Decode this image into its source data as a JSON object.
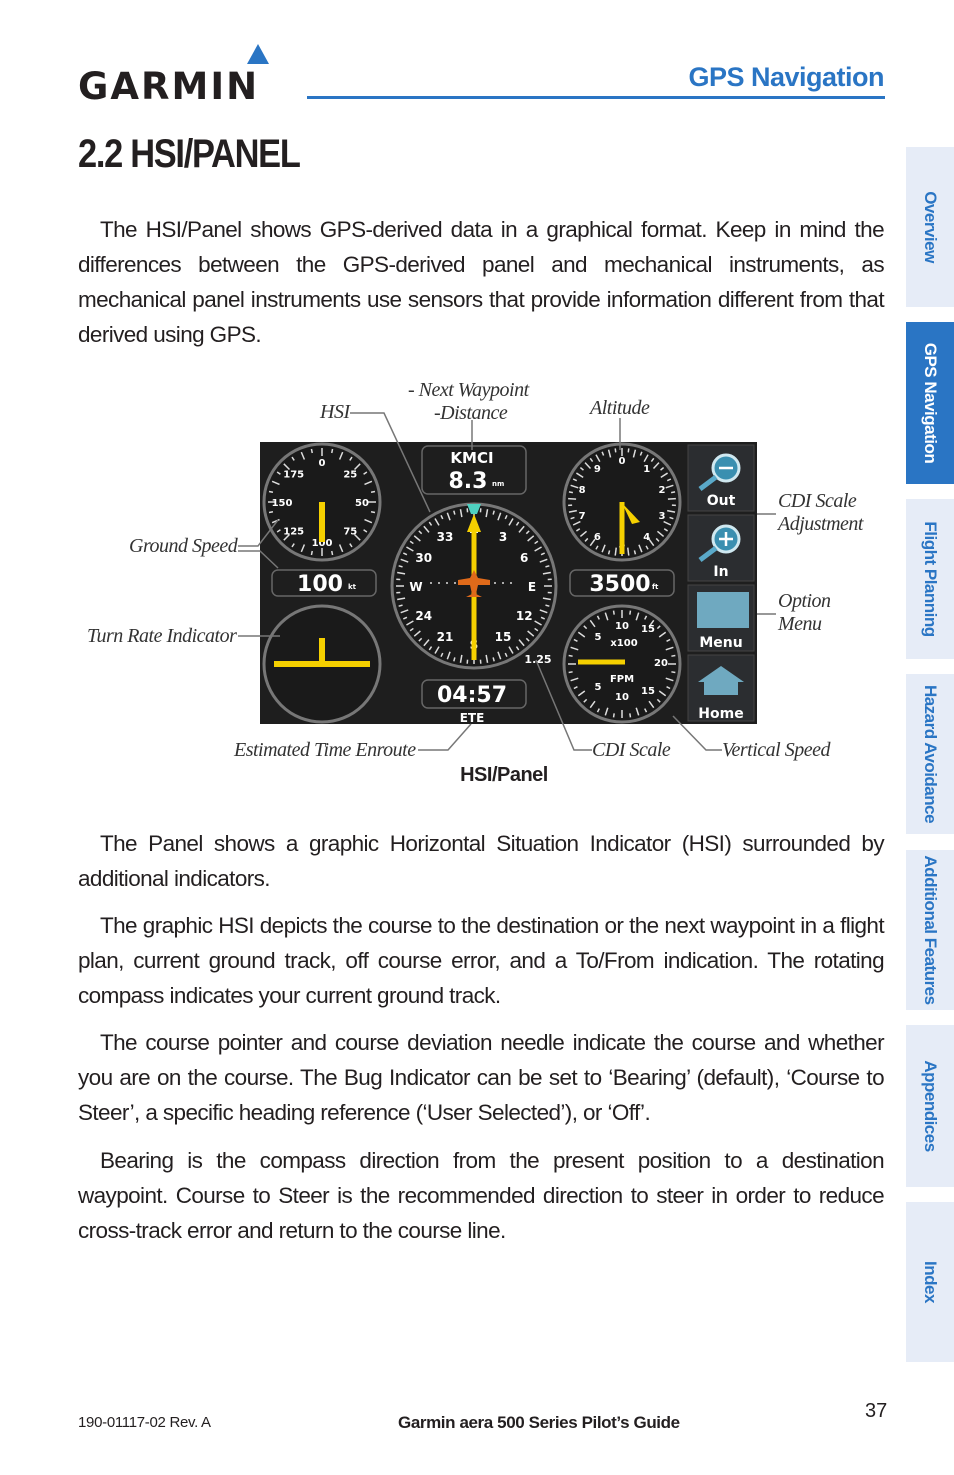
{
  "header": {
    "logo_text": "GARMIN",
    "section_title": "GPS Navigation",
    "page_heading": "2.2  HSI/PANEL"
  },
  "body": {
    "paragraphs": [
      "The HSI/Panel shows GPS-derived data in a graphical format.  Keep in mind the differences between the GPS-derived panel and mechanical instruments, as mechanical panel instruments use sensors that provide information different from that derived using GPS.",
      "The Panel shows a graphic Horizontal Situation Indicator (HSI) surrounded by additional indicators.",
      "The graphic HSI depicts the course to the destination or the next waypoint in a flight plan, current ground track, off course error, and a To/From indication.  The rotating compass indicates your current ground track.",
      "The course pointer and course deviation needle indicate the course and whether you are on the course.  The Bug Indicator can be set to ‘Bearing’ (default), ‘Course to Steer’, a specific heading reference (‘User Selected’), or ‘Off’.",
      "Bearing is the compass direction from the present position to a destination waypoint. Course to Steer is the recommended direction to steer in order to reduce cross-track error and return to the course line."
    ]
  },
  "figure": {
    "caption": "HSI/Panel",
    "callouts": {
      "hsi": "HSI",
      "next_waypoint_1": "- Next Waypoint",
      "next_waypoint_2": "-Distance",
      "altitude": "Altitude",
      "ground_speed": "Ground Speed",
      "turn_rate": "Turn Rate Indicator",
      "ete": "Estimated Time Enroute",
      "cdi_scale": "CDI Scale",
      "vertical_speed": "Vertical Speed",
      "cdi_adjust_1": "CDI Scale",
      "cdi_adjust_2": "Adjustment",
      "option_menu_1": "Option",
      "option_menu_2": "Menu"
    },
    "panel": {
      "waypoint": "KMCI",
      "distance": "8.3",
      "distance_unit": "nm",
      "ground_speed": "100",
      "ground_speed_unit": "kt",
      "altitude": "3500",
      "altitude_unit": "ft",
      "ete_value": "04:57",
      "ete_label": "ETE",
      "cdi_scale": "1.25",
      "speed_ticks": [
        "0",
        "25",
        "50",
        "75",
        "100",
        "125",
        "150",
        "175"
      ],
      "alt_ticks": [
        "0",
        "1",
        "2",
        "3",
        "4",
        "5",
        "6",
        "7",
        "8",
        "9"
      ],
      "compass_labels": [
        "N",
        "3",
        "6",
        "E",
        "12",
        "15",
        "S",
        "21",
        "24",
        "W",
        "30",
        "33"
      ],
      "vsi_labels": {
        "up10": "10",
        "up15": "15",
        "up5": "5",
        "x": "x100",
        "up20": "20",
        "fpm": "FPM",
        "dn5": "5",
        "dn10": "10",
        "dn15": "15"
      },
      "buttons": {
        "out": "Out",
        "in": "In",
        "menu": "Menu",
        "home": "Home"
      },
      "colors": {
        "background": "#1e1e1e",
        "needle": "#f5d000",
        "aircraft": "#e06a1a",
        "bearing_bug": "#4fd0c0"
      }
    }
  },
  "side_tabs": [
    {
      "label": "Overview",
      "active": false
    },
    {
      "label": "GPS Navigation",
      "active": true
    },
    {
      "label": "Flight Planning",
      "active": false
    },
    {
      "label": "Hazard Avoidance",
      "active": false
    },
    {
      "label": "Additional Features",
      "active": false
    },
    {
      "label": "Appendices",
      "active": false
    },
    {
      "label": "Index",
      "active": false
    }
  ],
  "footer": {
    "doc_number": "190-01117-02 Rev. A",
    "guide_title": "Garmin aera 500 Series Pilot’s Guide",
    "page_number": "37"
  },
  "colors": {
    "accent": "#2a75c4",
    "tab_bg": "#e6ecf7"
  }
}
